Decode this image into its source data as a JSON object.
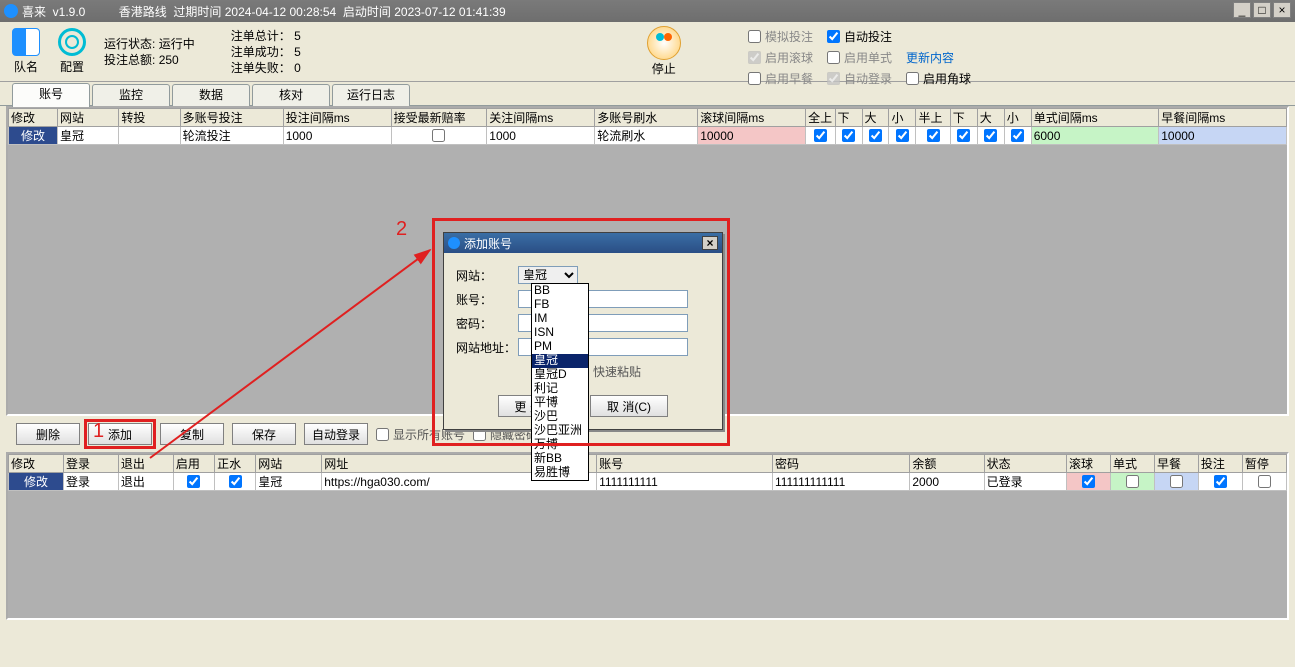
{
  "title": {
    "app": "喜来  v1.9.0",
    "route": "香港路线",
    "expire_label": "过期时间",
    "expire": "2024-04-12 00:28:54",
    "start_label": "启动时间",
    "start": "2023-07-12 01:41:39"
  },
  "toolbar": {
    "team": "队名",
    "config": "配置",
    "run_state_label": "运行状态:",
    "run_state": "运行中",
    "bet_total_label": "投注总额:",
    "bet_total": "250",
    "order_total_label": "注单总计：",
    "order_total": "5",
    "order_ok_label": "注单成功：",
    "order_ok": "5",
    "order_fail_label": "注单失败：",
    "order_fail": "0",
    "stop": "停止",
    "chk_sim": "模拟投注",
    "chk_auto": "自动投注",
    "chk_roll": "启用滚球",
    "chk_single": "启用单式",
    "chk_morning": "启用早餐",
    "update_link": "更新内容",
    "chk_autologin": "自动登录",
    "chk_corner": "启用角球"
  },
  "tabs": [
    "账号",
    "监控",
    "数据",
    "核对",
    "运行日志"
  ],
  "grid1": {
    "headers": [
      "修改",
      "网站",
      "转投",
      "多账号投注",
      "投注间隔ms",
      "接受最新赔率",
      "关注间隔ms",
      "多账号刷水",
      "滚球间隔ms",
      "全上",
      "下",
      "大",
      "小",
      "半上",
      "下",
      "大",
      "小",
      "单式间隔ms",
      "早餐间隔ms"
    ],
    "row": {
      "mod": "修改",
      "site": "皇冠",
      "trans": "",
      "multi": "轮流投注",
      "bet_int": "1000",
      "accept": false,
      "watch_int": "1000",
      "multi_shui": "轮流刷水",
      "roll_int": "10000",
      "c0": true,
      "c1": true,
      "c2": true,
      "c3": true,
      "c4": true,
      "c5": true,
      "c6": true,
      "c7": true,
      "single_int": "6000",
      "morn_int": "10000"
    }
  },
  "btnbar": {
    "del": "删除",
    "add": "添加",
    "copy": "复制",
    "save": "保存",
    "autologin": "自动登录",
    "showall": "显示所有账号",
    "hidepwd": "隐藏密码"
  },
  "grid2": {
    "headers": [
      "修改",
      "登录",
      "退出",
      "启用",
      "正水",
      "网站",
      "网址",
      "账号",
      "密码",
      "余额",
      "状态",
      "滚球",
      "单式",
      "早餐",
      "投注",
      "暂停"
    ],
    "row": {
      "mod": "修改",
      "login": "登录",
      "logout": "退出",
      "enable": true,
      "zhengshui": true,
      "site": "皇冠",
      "url": "https://hga030.com/",
      "account": "1111111111",
      "pwd": "111111111111",
      "balance": "2000",
      "state": "已登录",
      "roll": true,
      "single": false,
      "morn": false,
      "bet": true,
      "pause": false
    }
  },
  "modal": {
    "title": "添加账号",
    "site_label": "网站：",
    "site_val": "皇冠",
    "account_label": "账号：",
    "pwd_label": "密码：",
    "url_label": "网站地址：",
    "quickpaste": "快速粘贴",
    "more": "更 多(M)",
    "cancel": "取 消(C)"
  },
  "dropdown": [
    "BB",
    "FB",
    "IM",
    "ISN",
    "PM",
    "皇冠",
    "皇冠D",
    "利记",
    "平博",
    "沙巴",
    "沙巴亚洲",
    "万博",
    "新BB",
    "易胜博"
  ],
  "dropdown_sel": 5,
  "ann": {
    "n1": "1",
    "n2": "2"
  }
}
